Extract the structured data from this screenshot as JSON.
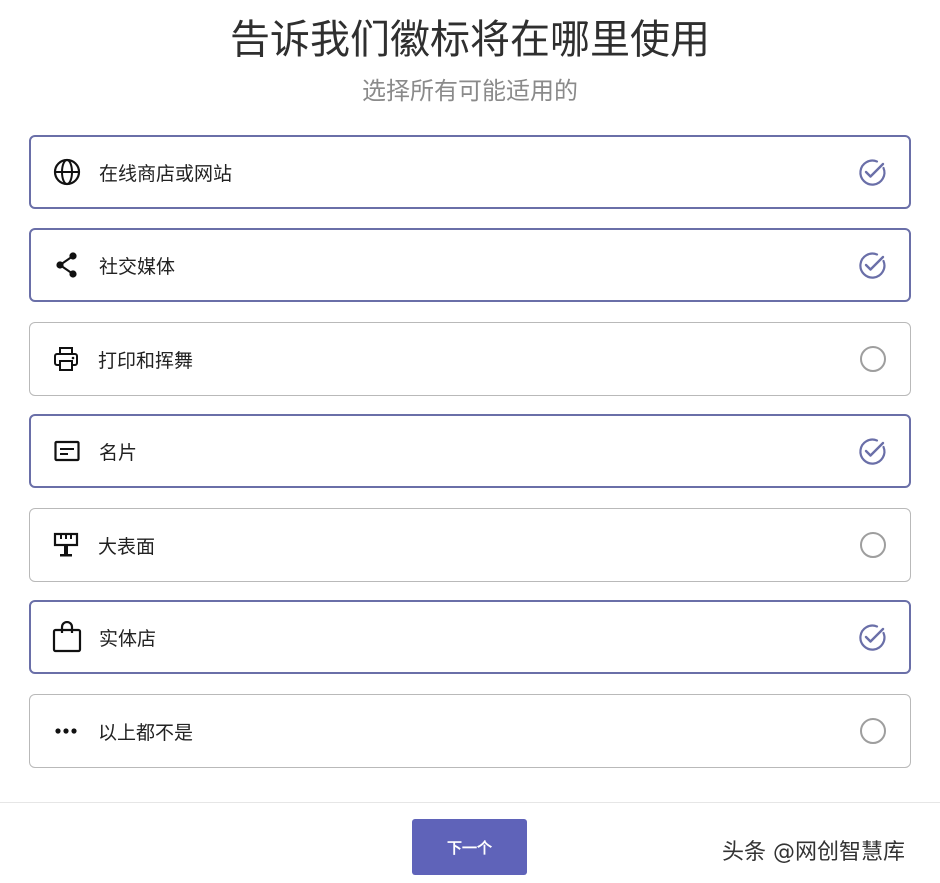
{
  "header": {
    "title": "告诉我们徽标将在哪里使用",
    "subtitle": "选择所有可能适用的"
  },
  "options": [
    {
      "label": "在线商店或网站",
      "icon": "globe-icon",
      "selected": true
    },
    {
      "label": "社交媒体",
      "icon": "share-icon",
      "selected": true
    },
    {
      "label": "打印和挥舞",
      "icon": "printer-icon",
      "selected": false
    },
    {
      "label": "名片",
      "icon": "business-card-icon",
      "selected": true
    },
    {
      "label": "大表面",
      "icon": "billboard-icon",
      "selected": false
    },
    {
      "label": "实体店",
      "icon": "shopping-bag-icon",
      "selected": true
    },
    {
      "label": "以上都不是",
      "icon": "more-horizontal-icon",
      "selected": false
    }
  ],
  "footer": {
    "next_label": "下一个",
    "watermark": "头条 @网创智慧库"
  },
  "colors": {
    "accent": "#5f63b9",
    "selected_border": "#6a6fa8",
    "unselected_border": "#b9b9b9",
    "check": "#6a6fa8",
    "radio": "#9e9e9e"
  }
}
